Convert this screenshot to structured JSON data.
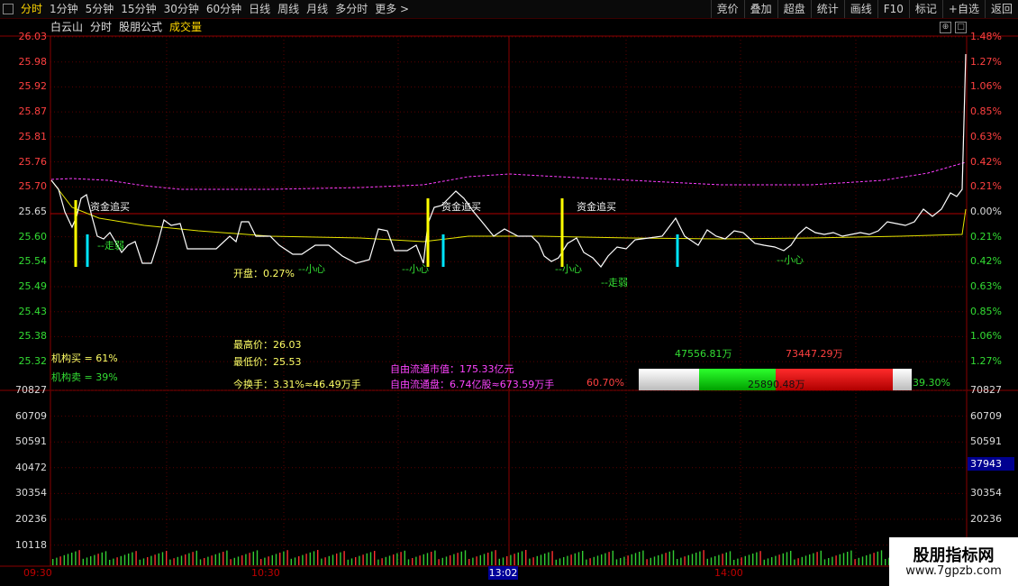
{
  "toolbar": {
    "left_items": [
      "分时",
      "1分钟",
      "5分钟",
      "15分钟",
      "30分钟",
      "60分钟",
      "日线",
      "周线",
      "月线",
      "多分时",
      "更多 >"
    ],
    "active_index": 0,
    "right_items": [
      "竞价",
      "叠加",
      "超盘",
      "统计",
      "画线",
      "F10",
      "标记",
      "+自选",
      "返回"
    ]
  },
  "info": {
    "stock_name": "白云山",
    "mode": "分时",
    "formula": "股朋公式",
    "volume_label": "成交量"
  },
  "price_axis": {
    "left": [
      "26.03",
      "25.98",
      "25.92",
      "25.87",
      "25.81",
      "25.76",
      "25.70",
      "25.65",
      "25.60",
      "25.54",
      "25.49",
      "25.43",
      "25.38",
      "25.32"
    ],
    "right": [
      "1.48%",
      "1.27%",
      "1.06%",
      "0.85%",
      "0.63%",
      "0.42%",
      "0.21%",
      "0.00%",
      "0.21%",
      "0.42%",
      "0.63%",
      "0.85%",
      "1.06%",
      "1.27%"
    ]
  },
  "volume_axis": {
    "left": [
      "70827",
      "60709",
      "50591",
      "40472",
      "30354",
      "20236",
      "10118"
    ],
    "right": [
      "70827",
      "60709",
      "50591",
      "40472",
      "30354",
      "20236",
      "10118"
    ],
    "current": "37943"
  },
  "time_axis": {
    "labels": [
      "09:30",
      "10:30",
      "14:00"
    ],
    "cursor": "13:02"
  },
  "annotations": {
    "buy_signal": "资金追买",
    "weak": "--走弱",
    "caution": "--小心",
    "open": "开盘：0.27%",
    "high": "最高价：26.03",
    "low": "最低价：25.53",
    "turnover": "今换手：3.31%≈46.49万手",
    "inst_buy": "机构买 = 61%",
    "inst_sell": "机构卖 = 39%",
    "free_cap": "自由流通市值：175.33亿元",
    "free_shares": "自由流通盘：6.74亿股≈673.59万手",
    "pct_left": "60.70%",
    "pct_right": "39.30%",
    "green_val": "47556.81万",
    "red_val": "73447.29万",
    "mid_val": "25890.48万"
  },
  "watermark": {
    "title": "股朋指标网",
    "url": "www.7gpzb.com"
  },
  "colors": {
    "up": "#ff4040",
    "down": "#33cc33",
    "grid": "#5a0000",
    "price": "#ffffff",
    "avg": "#e6e600",
    "signal_yellow": "#ffff00",
    "signal_cyan": "#00e5ff",
    "ma_magenta": "#ff3cff"
  }
}
